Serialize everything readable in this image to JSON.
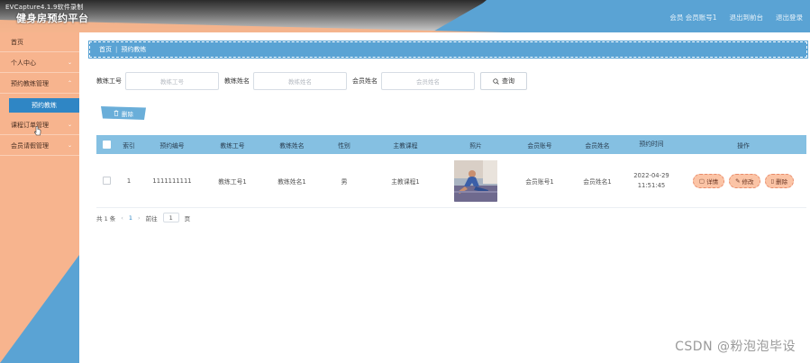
{
  "header": {
    "watermark": "EVCapture4.1.9软件录制",
    "brand": "健身房预约平台",
    "links": [
      "会员 会员账号1",
      "退出到前台",
      "退出登录"
    ]
  },
  "sidebar": {
    "items": [
      {
        "label": "首页",
        "has_children": false
      },
      {
        "label": "个人中心",
        "has_children": true
      },
      {
        "label": "预约教练管理",
        "has_children": true
      },
      {
        "label": "课程订单管理",
        "has_children": true
      },
      {
        "label": "会员请假管理",
        "has_children": true
      }
    ],
    "active_sub": "预约教练"
  },
  "breadcrumb": {
    "home": "首页",
    "current": "预约教练"
  },
  "search": {
    "fields": [
      {
        "label": "教练工号",
        "placeholder": "教练工号"
      },
      {
        "label": "教练姓名",
        "placeholder": "教练姓名"
      },
      {
        "label": "会员姓名",
        "placeholder": "会员姓名"
      }
    ],
    "button": "查询"
  },
  "actions": {
    "delete": "删除"
  },
  "table": {
    "headers": [
      "索引",
      "预约编号",
      "教练工号",
      "教练姓名",
      "性别",
      "主教课程",
      "照片",
      "会员账号",
      "会员姓名",
      "预约时间",
      "操作"
    ],
    "rows": [
      {
        "index": "1",
        "no": "1111111111",
        "coach_no": "教练工号1",
        "coach_name": "教练姓名1",
        "sex": "男",
        "course": "主教课程1",
        "member_no": "会员账号1",
        "member_name": "会员姓名1",
        "time": "2022-04-29 11:51:45",
        "ops": [
          "详情",
          "修改",
          "删除"
        ]
      }
    ]
  },
  "pager": {
    "total": "共 1 条",
    "page": "1",
    "goto": "前往",
    "goto_value": "1",
    "unit": "页"
  },
  "footer_watermark": "CSDN @粉泡泡毕设"
}
